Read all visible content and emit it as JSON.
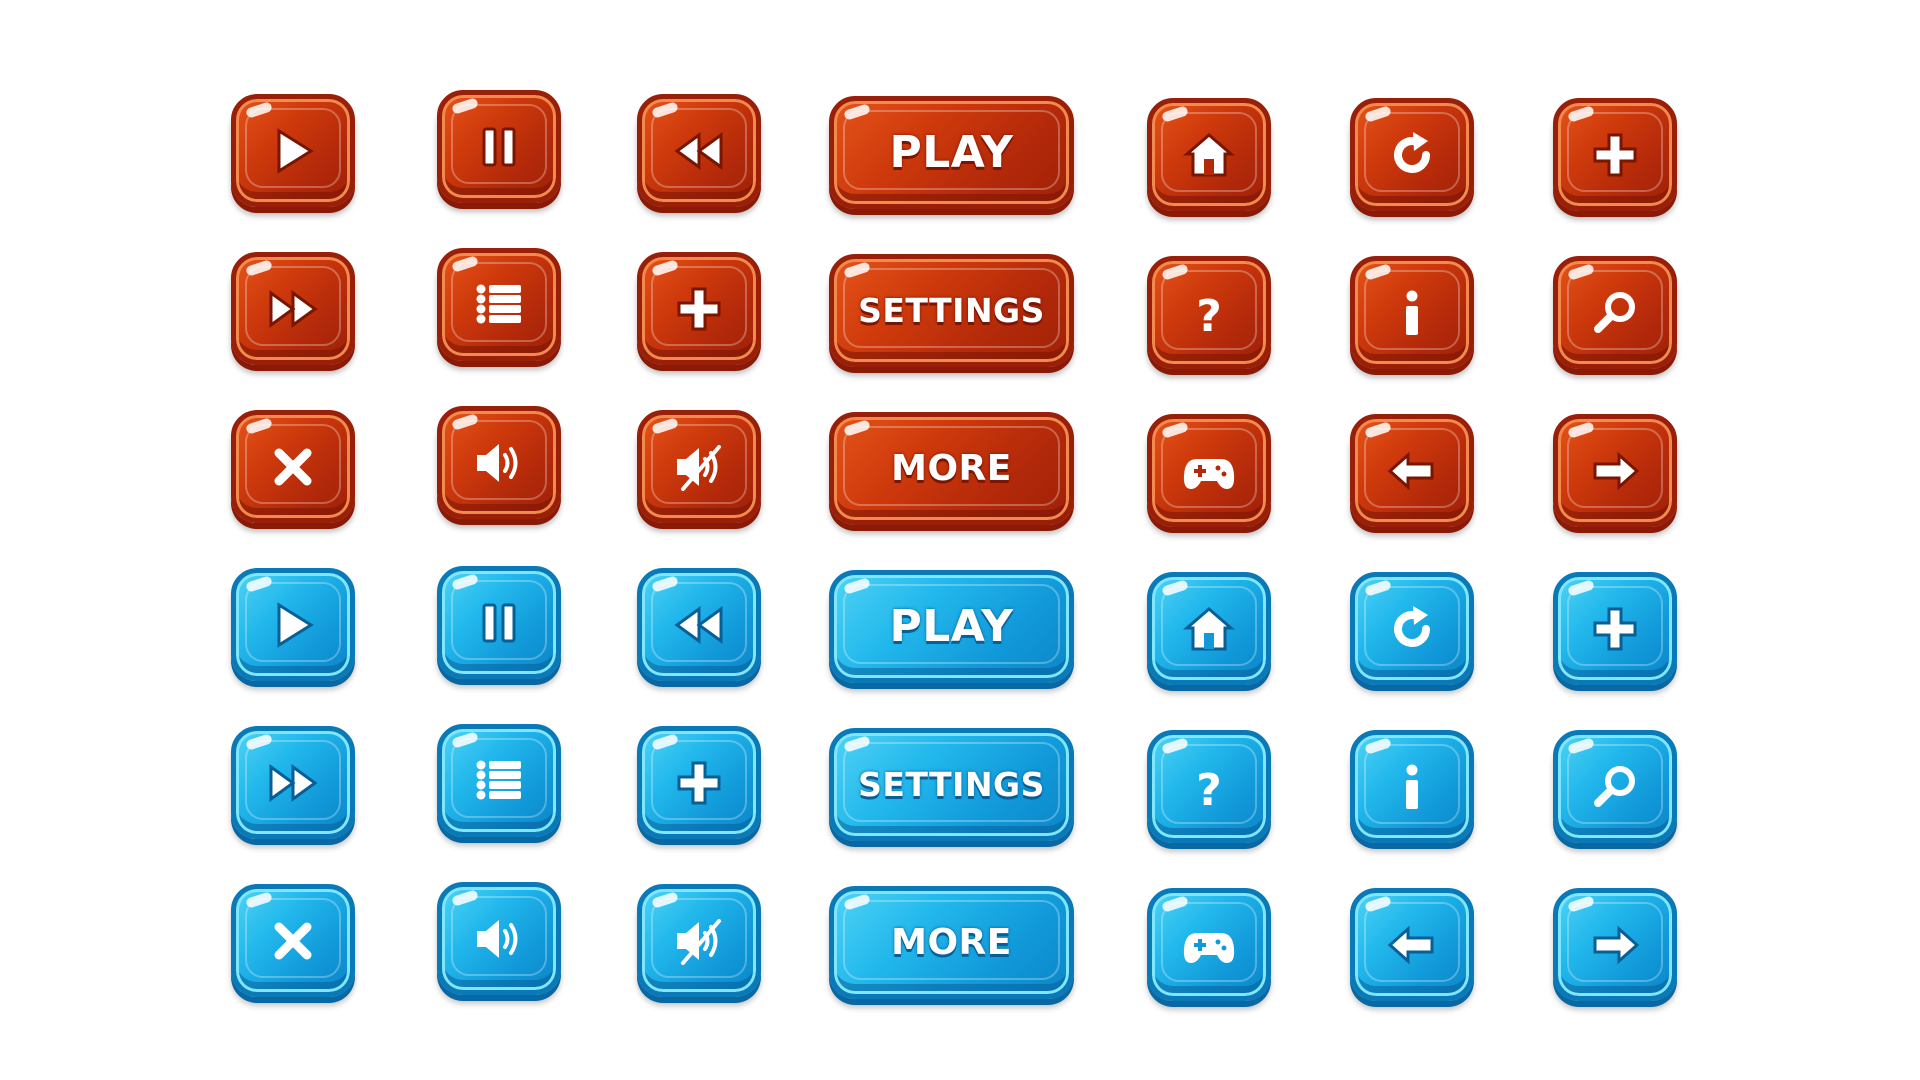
{
  "labels": {
    "play": "PLAY",
    "settings": "SETTINGS",
    "more": "MORE"
  },
  "colors": {
    "red_theme": "#cf3a0c",
    "blue_theme": "#22b8ec"
  },
  "sets": [
    {
      "theme": "red",
      "rows": [
        [
          "play-icon",
          "pause-icon",
          "rewind-icon",
          "label:play",
          "home-icon",
          "refresh-icon",
          "plus-icon"
        ],
        [
          "fast-forward-icon",
          "list-icon",
          "plus-icon",
          "label:settings",
          "question-icon",
          "info-icon",
          "search-icon"
        ],
        [
          "close-icon",
          "volume-icon",
          "mute-icon",
          "label:more",
          "gamepad-icon",
          "arrow-left-icon",
          "arrow-right-icon"
        ]
      ]
    },
    {
      "theme": "blue",
      "rows": [
        [
          "play-icon",
          "pause-icon",
          "rewind-icon",
          "label:play",
          "home-icon",
          "refresh-icon",
          "plus-icon"
        ],
        [
          "fast-forward-icon",
          "list-icon",
          "plus-icon",
          "label:settings",
          "question-icon",
          "info-icon",
          "search-icon"
        ],
        [
          "close-icon",
          "volume-icon",
          "mute-icon",
          "label:more",
          "gamepad-icon",
          "arrow-left-icon",
          "arrow-right-icon"
        ]
      ]
    }
  ]
}
